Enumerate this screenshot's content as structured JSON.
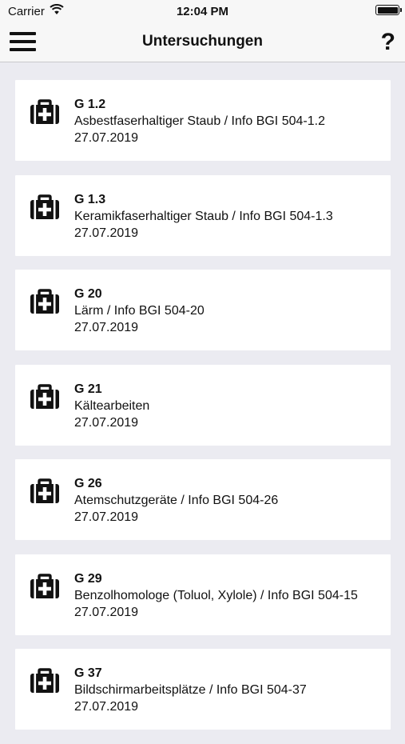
{
  "status": {
    "carrier": "Carrier",
    "time": "12:04 PM"
  },
  "nav": {
    "title": "Untersuchungen",
    "help": "?"
  },
  "items": [
    {
      "code": "G 1.2",
      "description": "Asbestfaserhaltiger Staub / Info BGI 504-1.2",
      "date": "27.07.2019"
    },
    {
      "code": "G 1.3",
      "description": "Keramikfaserhaltiger Staub / Info BGI 504-1.3",
      "date": "27.07.2019"
    },
    {
      "code": "G 20",
      "description": "Lärm / Info BGI 504-20",
      "date": "27.07.2019"
    },
    {
      "code": "G 21",
      "description": "Kältearbeiten",
      "date": "27.07.2019"
    },
    {
      "code": "G 26",
      "description": "Atemschutzgeräte / Info BGI 504-26",
      "date": "27.07.2019"
    },
    {
      "code": "G 29",
      "description": "Benzolhomologe (Toluol, Xylole) / Info BGI 504-15",
      "date": "27.07.2019"
    },
    {
      "code": "G 37",
      "description": "Bildschirmarbeitsplätze / Info BGI 504-37",
      "date": "27.07.2019"
    }
  ]
}
